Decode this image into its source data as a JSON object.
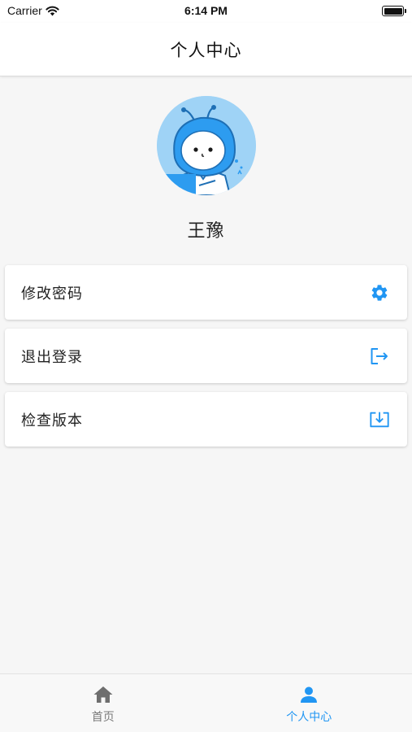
{
  "status_bar": {
    "carrier": "Carrier",
    "time": "6:14 PM"
  },
  "nav": {
    "title": "个人中心"
  },
  "profile": {
    "name": "王豫"
  },
  "menu": [
    {
      "label": "修改密码",
      "icon": "gear-icon"
    },
    {
      "label": "退出登录",
      "icon": "logout-icon"
    },
    {
      "label": "检查版本",
      "icon": "download-icon"
    }
  ],
  "tabs": [
    {
      "label": "首页",
      "icon": "home-icon",
      "active": false
    },
    {
      "label": "个人中心",
      "icon": "person-icon",
      "active": true
    }
  ],
  "colors": {
    "accent": "#2196f3",
    "inactive": "#7a7a7a",
    "avatar_bg": "#9fd3f6"
  }
}
